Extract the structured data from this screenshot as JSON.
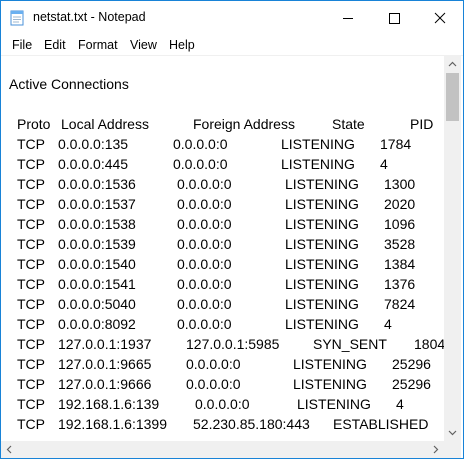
{
  "window": {
    "title": "netstat.txt - Notepad"
  },
  "menu": [
    "File",
    "Edit",
    "Format",
    "View",
    "Help"
  ],
  "document": {
    "heading": "Active Connections",
    "columns": [
      "Proto",
      "Local Address",
      "Foreign Address",
      "State",
      "PID"
    ],
    "rows": [
      [
        "TCP",
        "0.0.0.0:135",
        "0.0.0.0:0",
        "LISTENING",
        "1784"
      ],
      [
        "TCP",
        "0.0.0.0:445",
        "0.0.0.0:0",
        "LISTENING",
        "4"
      ],
      [
        "TCP",
        "0.0.0.0:1536",
        "0.0.0.0:0",
        "LISTENING",
        "1300"
      ],
      [
        "TCP",
        "0.0.0.0:1537",
        "0.0.0.0:0",
        "LISTENING",
        "2020"
      ],
      [
        "TCP",
        "0.0.0.0:1538",
        "0.0.0.0:0",
        "LISTENING",
        "1096"
      ],
      [
        "TCP",
        "0.0.0.0:1539",
        "0.0.0.0:0",
        "LISTENING",
        "3528"
      ],
      [
        "TCP",
        "0.0.0.0:1540",
        "0.0.0.0:0",
        "LISTENING",
        "1384"
      ],
      [
        "TCP",
        "0.0.0.0:1541",
        "0.0.0.0:0",
        "LISTENING",
        "1376"
      ],
      [
        "TCP",
        "0.0.0.0:5040",
        "0.0.0.0:0",
        "LISTENING",
        "7824"
      ],
      [
        "TCP",
        "0.0.0.0:8092",
        "0.0.0.0:0",
        "LISTENING",
        "4"
      ],
      [
        "TCP",
        "127.0.0.1:1937",
        "127.0.0.1:5985",
        "SYN_SENT",
        "1804"
      ],
      [
        "TCP",
        "127.0.0.1:9665",
        "0.0.0.0:0",
        "LISTENING",
        "25296"
      ],
      [
        "TCP",
        "127.0.0.1:9666",
        "0.0.0.0:0",
        "LISTENING",
        "25296"
      ],
      [
        "TCP",
        "192.168.1.6:139",
        "0.0.0.0:0",
        "LISTENING",
        "4"
      ],
      [
        "TCP",
        "192.168.1.6:1399",
        "52.230.85.180:443",
        "ESTABLISHED",
        ""
      ]
    ]
  },
  "colors": {
    "accent": "#1883d7",
    "scrollbar": "#f0f0f0",
    "thumb": "#c2c2c2"
  }
}
